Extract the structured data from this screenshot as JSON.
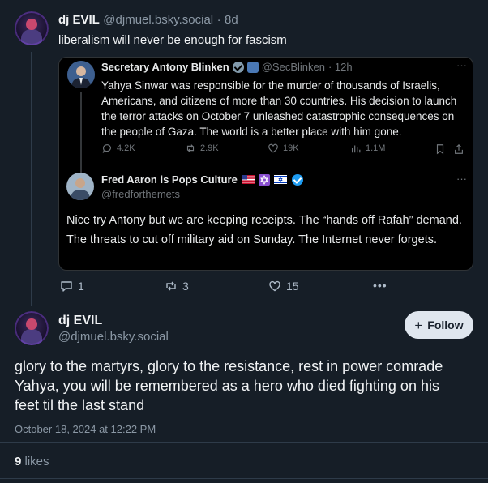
{
  "parent_post": {
    "author_name": "dj EVIL",
    "handle": "@djmuel.bsky.social",
    "separator": "·",
    "age": "8d",
    "text": "liberalism will never be enough for fascism",
    "actions": {
      "replies": "1",
      "reposts": "3",
      "likes": "15",
      "more": "•••"
    }
  },
  "quoted_tweet": {
    "author_name": "Secretary Antony Blinken",
    "handle": "@SecBlinken",
    "age": "· 12h",
    "more": "···",
    "text": "Yahya Sinwar was responsible for the murder of thousands of Israelis, Americans, and citizens of more than 30 countries. His decision to launch the terror attacks on October 7 unleashed catastrophic consequences on the people of Gaza. The world is a better place with him gone.",
    "metrics": {
      "replies": "4.2K",
      "reposts": "2.9K",
      "likes": "19K",
      "views": "1.1M"
    }
  },
  "reply_tweet": {
    "author_name": "Fred Aaron is Pops Culture",
    "handle": "@fredforthemets",
    "more": "···",
    "text": "Nice try Antony but we are keeping receipts. The “hands off Rafah” demand. The threats to cut off military aid on Sunday. The Internet never forgets."
  },
  "main_post": {
    "author_name": "dj EVIL",
    "handle": "@djmuel.bsky.social",
    "follow_label": "Follow",
    "text": "glory to the martyrs, glory to the resistance, rest in power comrade Yahya, you will be remembered as a hero who died fighting on his feet til the last stand",
    "timestamp": "October 18, 2024 at 12:22 PM",
    "likes_count": "9",
    "likes_label": "likes"
  },
  "colors": {
    "background": "#161e27",
    "card": "#000000",
    "verified_blue": "#1d9bf0",
    "follow_bg": "#dfe6ee"
  }
}
